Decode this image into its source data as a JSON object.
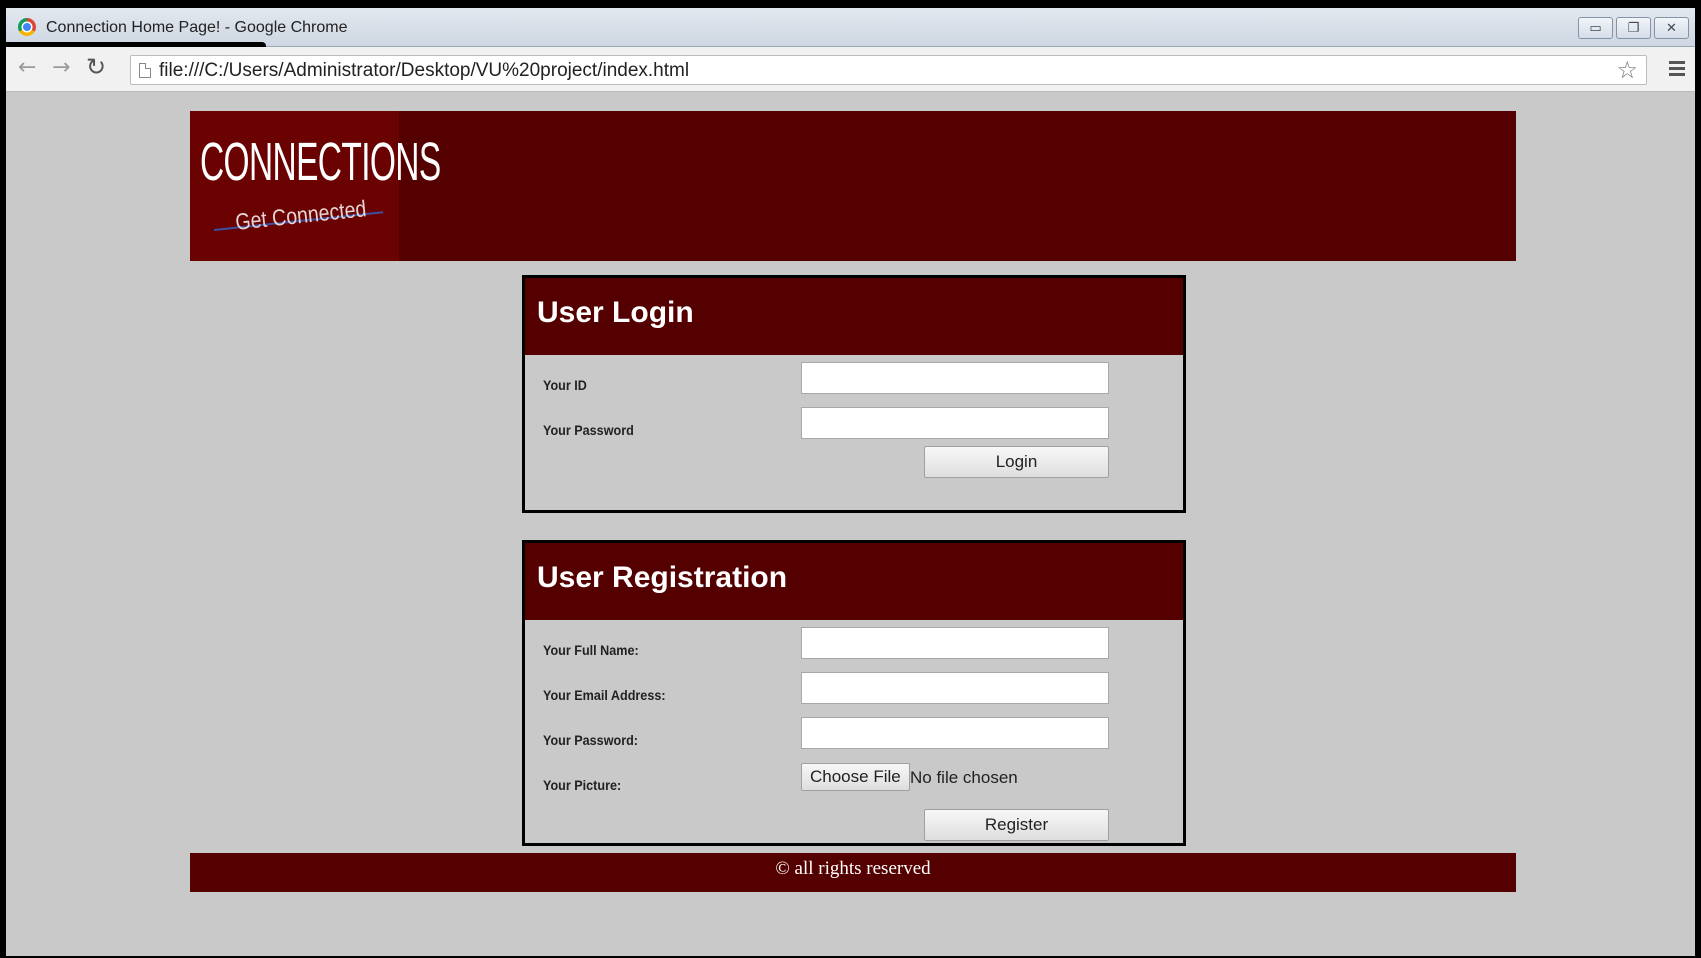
{
  "window": {
    "title": "Connection Home Page! - Google Chrome"
  },
  "toolbar": {
    "url": "file:///C:/Users/Administrator/Desktop/VU%20project/index.html"
  },
  "header": {
    "logo_main": "CONNECTIONS",
    "logo_sub": "Get Connected"
  },
  "login": {
    "title": "User Login",
    "id_label": "Your ID",
    "password_label": "Your Password",
    "button": "Login"
  },
  "register": {
    "title": "User Registration",
    "name_label": "Your Full Name:",
    "email_label": "Your Email Address:",
    "password_label": "Your Password:",
    "picture_label": "Your Picture:",
    "file_button": "Choose File",
    "file_status": "No file chosen",
    "button": "Register"
  },
  "footer": {
    "text": "© all rights reserved"
  },
  "colors": {
    "brand": "#550000",
    "page_bg": "#c9c9c9"
  }
}
